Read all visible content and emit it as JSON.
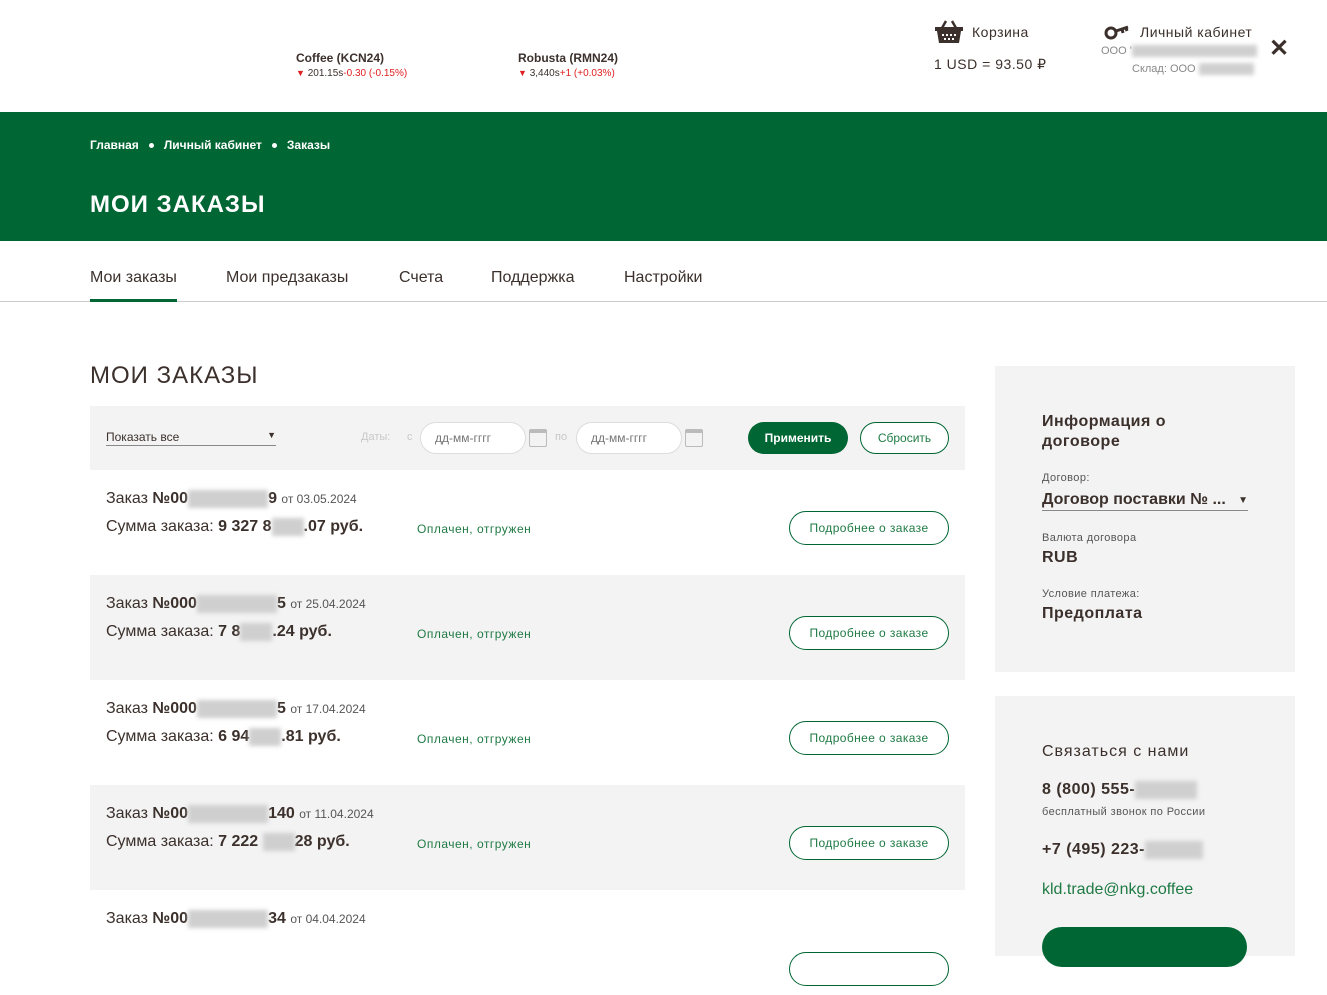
{
  "tickers": [
    {
      "name": "Coffee (KCN24)",
      "price": "201.15s",
      "change": "-0.30 (-0.15%)"
    },
    {
      "name": "Robusta (RMN24)",
      "price": "3,440s",
      "change": "+1 (+0.03%)"
    }
  ],
  "cart": {
    "label": "Корзина",
    "rate": "1 USD = 93.50 ₽"
  },
  "account": {
    "label": "Личный кабинет",
    "company_prefix": "ООО '",
    "warehouse_prefix": "Склад: ООО"
  },
  "breadcrumbs": [
    "Главная",
    "Личный кабинет",
    "Заказы"
  ],
  "page_title": "МОИ ЗАКАЗЫ",
  "tabs": [
    "Мои заказы",
    "Мои предзаказы",
    "Счета",
    "Поддержка",
    "Настройки"
  ],
  "section_title": "МОИ ЗАКАЗЫ",
  "filter": {
    "show": "Показать все",
    "dates_label": "Даты:",
    "from": "с",
    "to": "по",
    "placeholder": "дд-мм-гггг",
    "apply": "Применить",
    "reset": "Сбросить"
  },
  "order_labels": {
    "order": "Заказ",
    "from": "от",
    "sum": "Сумма заказа:",
    "details": "Подробнее о заказе"
  },
  "orders": [
    {
      "num_a": "№00",
      "num_b": "9",
      "date": "03.05.2024",
      "sum_a": "9 327 8",
      "sum_b": ".07 руб.",
      "status": "Оплачен, отгружен"
    },
    {
      "num_a": "№000",
      "num_b": "5",
      "date": "25.04.2024",
      "sum_a": "7 8",
      "sum_b": ".24 руб.",
      "status": "Оплачен, отгружен"
    },
    {
      "num_a": "№000",
      "num_b": "5",
      "date": "17.04.2024",
      "sum_a": "6 94",
      "sum_b": ".81 руб.",
      "status": "Оплачен, отгружен"
    },
    {
      "num_a": "№00",
      "num_b": "140",
      "date": "11.04.2024",
      "sum_a": "7 222 ",
      "sum_b": "28 руб.",
      "status": "Оплачен, отгружен"
    },
    {
      "num_a": "№00",
      "num_b": "34",
      "date": "04.04.2024"
    }
  ],
  "contract": {
    "title": "Информация о договоре",
    "contract_label": "Договор:",
    "contract_value": "Договор поставки № ...",
    "currency_label": "Валюта договора",
    "currency": "RUB",
    "payment_label": "Условие платежа:",
    "payment": "Предоплата"
  },
  "contact": {
    "title": "Связаться с нами",
    "phone1": "8 (800) 555-",
    "phone1_note": "бесплатный звонок по России",
    "phone2": "+7 (495) 223-",
    "email": "kld.trade@nkg.coffee"
  },
  "colors": {
    "brand": "#006633",
    "negative": "#e02020"
  }
}
